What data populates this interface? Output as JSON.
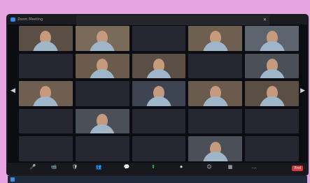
{
  "window": {
    "title": "Zoom Meeting"
  },
  "banner": {
    "left_text": "",
    "right_text": "",
    "close_glyph": "✕"
  },
  "participants": [
    {
      "name": "",
      "video": true
    },
    {
      "name": "",
      "video": true
    },
    {
      "name": "",
      "video": false
    },
    {
      "name": "",
      "video": true
    },
    {
      "name": "",
      "video": true
    },
    {
      "name": "",
      "video": false
    },
    {
      "name": "",
      "video": true
    },
    {
      "name": "",
      "video": true
    },
    {
      "name": "",
      "video": false
    },
    {
      "name": "",
      "video": true
    },
    {
      "name": "",
      "video": true
    },
    {
      "name": "",
      "video": false
    },
    {
      "name": "",
      "video": true
    },
    {
      "name": "",
      "video": true
    },
    {
      "name": "",
      "video": true
    },
    {
      "name": "",
      "video": false
    },
    {
      "name": "",
      "video": true
    },
    {
      "name": "",
      "video": false
    },
    {
      "name": "",
      "video": false
    },
    {
      "name": "",
      "video": false
    },
    {
      "name": "",
      "video": false
    },
    {
      "name": "",
      "video": false
    },
    {
      "name": "",
      "video": false
    },
    {
      "name": "",
      "video": true
    },
    {
      "name": "",
      "video": false
    }
  ],
  "toolbar": {
    "items": [
      {
        "icon": "microphone-icon",
        "glyph": "🎤",
        "label": ""
      },
      {
        "icon": "video-icon",
        "glyph": "📹",
        "label": ""
      },
      {
        "icon": "security-icon",
        "glyph": "🛡",
        "label": ""
      },
      {
        "icon": "participants-icon",
        "glyph": "👥",
        "label": ""
      },
      {
        "icon": "chat-icon",
        "glyph": "💬",
        "label": ""
      },
      {
        "icon": "share-screen-icon",
        "glyph": "⬆",
        "label": ""
      },
      {
        "icon": "record-icon",
        "glyph": "⏺",
        "label": ""
      },
      {
        "icon": "reactions-icon",
        "glyph": "☺",
        "label": ""
      },
      {
        "icon": "apps-icon",
        "glyph": "▦",
        "label": ""
      },
      {
        "icon": "more-icon",
        "glyph": "…",
        "label": ""
      }
    ],
    "end_label": "End"
  },
  "navigation": {
    "prev_glyph": "◀",
    "next_glyph": "▶"
  },
  "colors": {
    "zoom_blue": "#2d8cff",
    "share_green": "#33c24d",
    "end_red": "#d23a3a"
  }
}
